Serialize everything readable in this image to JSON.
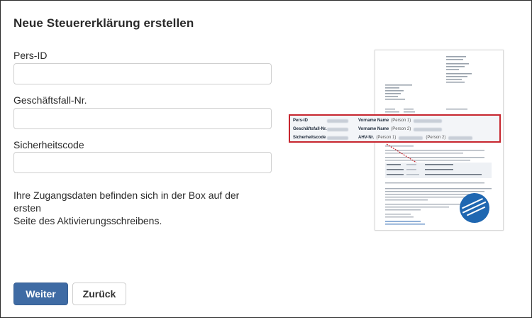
{
  "dialog": {
    "title": "Neue Steuererklärung erstellen"
  },
  "form": {
    "pers_id": {
      "label": "Pers-ID",
      "value": "",
      "placeholder": ""
    },
    "geschaeftsfall": {
      "label": "Geschäftsfall-Nr.",
      "value": "",
      "placeholder": ""
    },
    "sicherheitscode": {
      "label": "Sicherheitscode",
      "value": "",
      "placeholder": ""
    }
  },
  "info": {
    "line1": "Ihre Zugangsdaten befinden sich in der Box auf der ersten",
    "line2": "Seite des Aktivierungsschreibens."
  },
  "buttons": {
    "primary": "Weiter",
    "secondary": "Zurück"
  },
  "letter_callout": {
    "row1_label": "Pers-ID",
    "row1_name_label": "Vorname Name",
    "row1_person": "(Person 1)",
    "row2_label": "Geschäftsfall-Nr.",
    "row2_name_label": "Vorname Name",
    "row2_person": "(Person 2)",
    "row3_label": "Sicherheitscode",
    "row3_ahv_label": "AHV-Nr.",
    "row3_person1": "(Person 1)",
    "row3_person2": "(Person 2)"
  },
  "colors": {
    "primary_button": "#3f6ba4",
    "callout_border": "#c7262f",
    "stamp": "#1f67b1"
  }
}
